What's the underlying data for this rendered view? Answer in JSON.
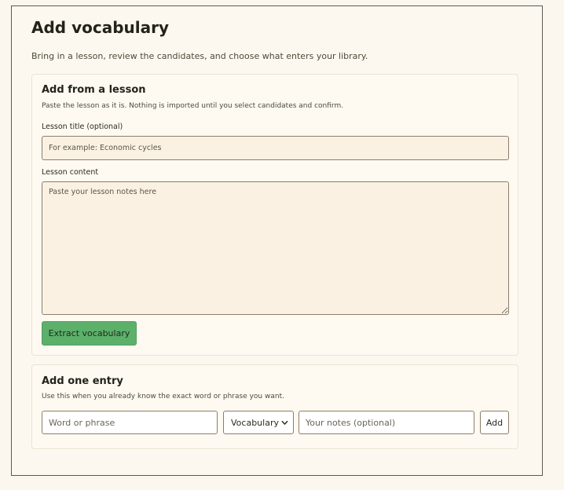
{
  "page": {
    "title": "Add vocabulary",
    "subtitle": "Bring in a lesson, review the candidates, and choose what enters your library."
  },
  "lesson_card": {
    "title": "Add from a lesson",
    "description": "Paste the lesson as it is. Nothing is imported until you select candidates and confirm.",
    "title_label": "Lesson title (optional)",
    "title_placeholder": "For example: Economic cycles",
    "title_value": "",
    "content_label": "Lesson content",
    "content_placeholder": "Paste your lesson notes here",
    "content_value": "",
    "extract_button": "Extract vocabulary"
  },
  "entry_card": {
    "title": "Add one entry",
    "description": "Use this when you already know the exact word or phrase you want.",
    "word_placeholder": "Word or phrase",
    "type_selected": "Vocabulary",
    "notes_placeholder": "Your notes (optional)",
    "add_button": "Add"
  },
  "colors": {
    "background": "#fbf7ee",
    "accent_button": "#5cb06a",
    "input_fill": "#fbf1e2",
    "border": "#8b7e6a"
  }
}
